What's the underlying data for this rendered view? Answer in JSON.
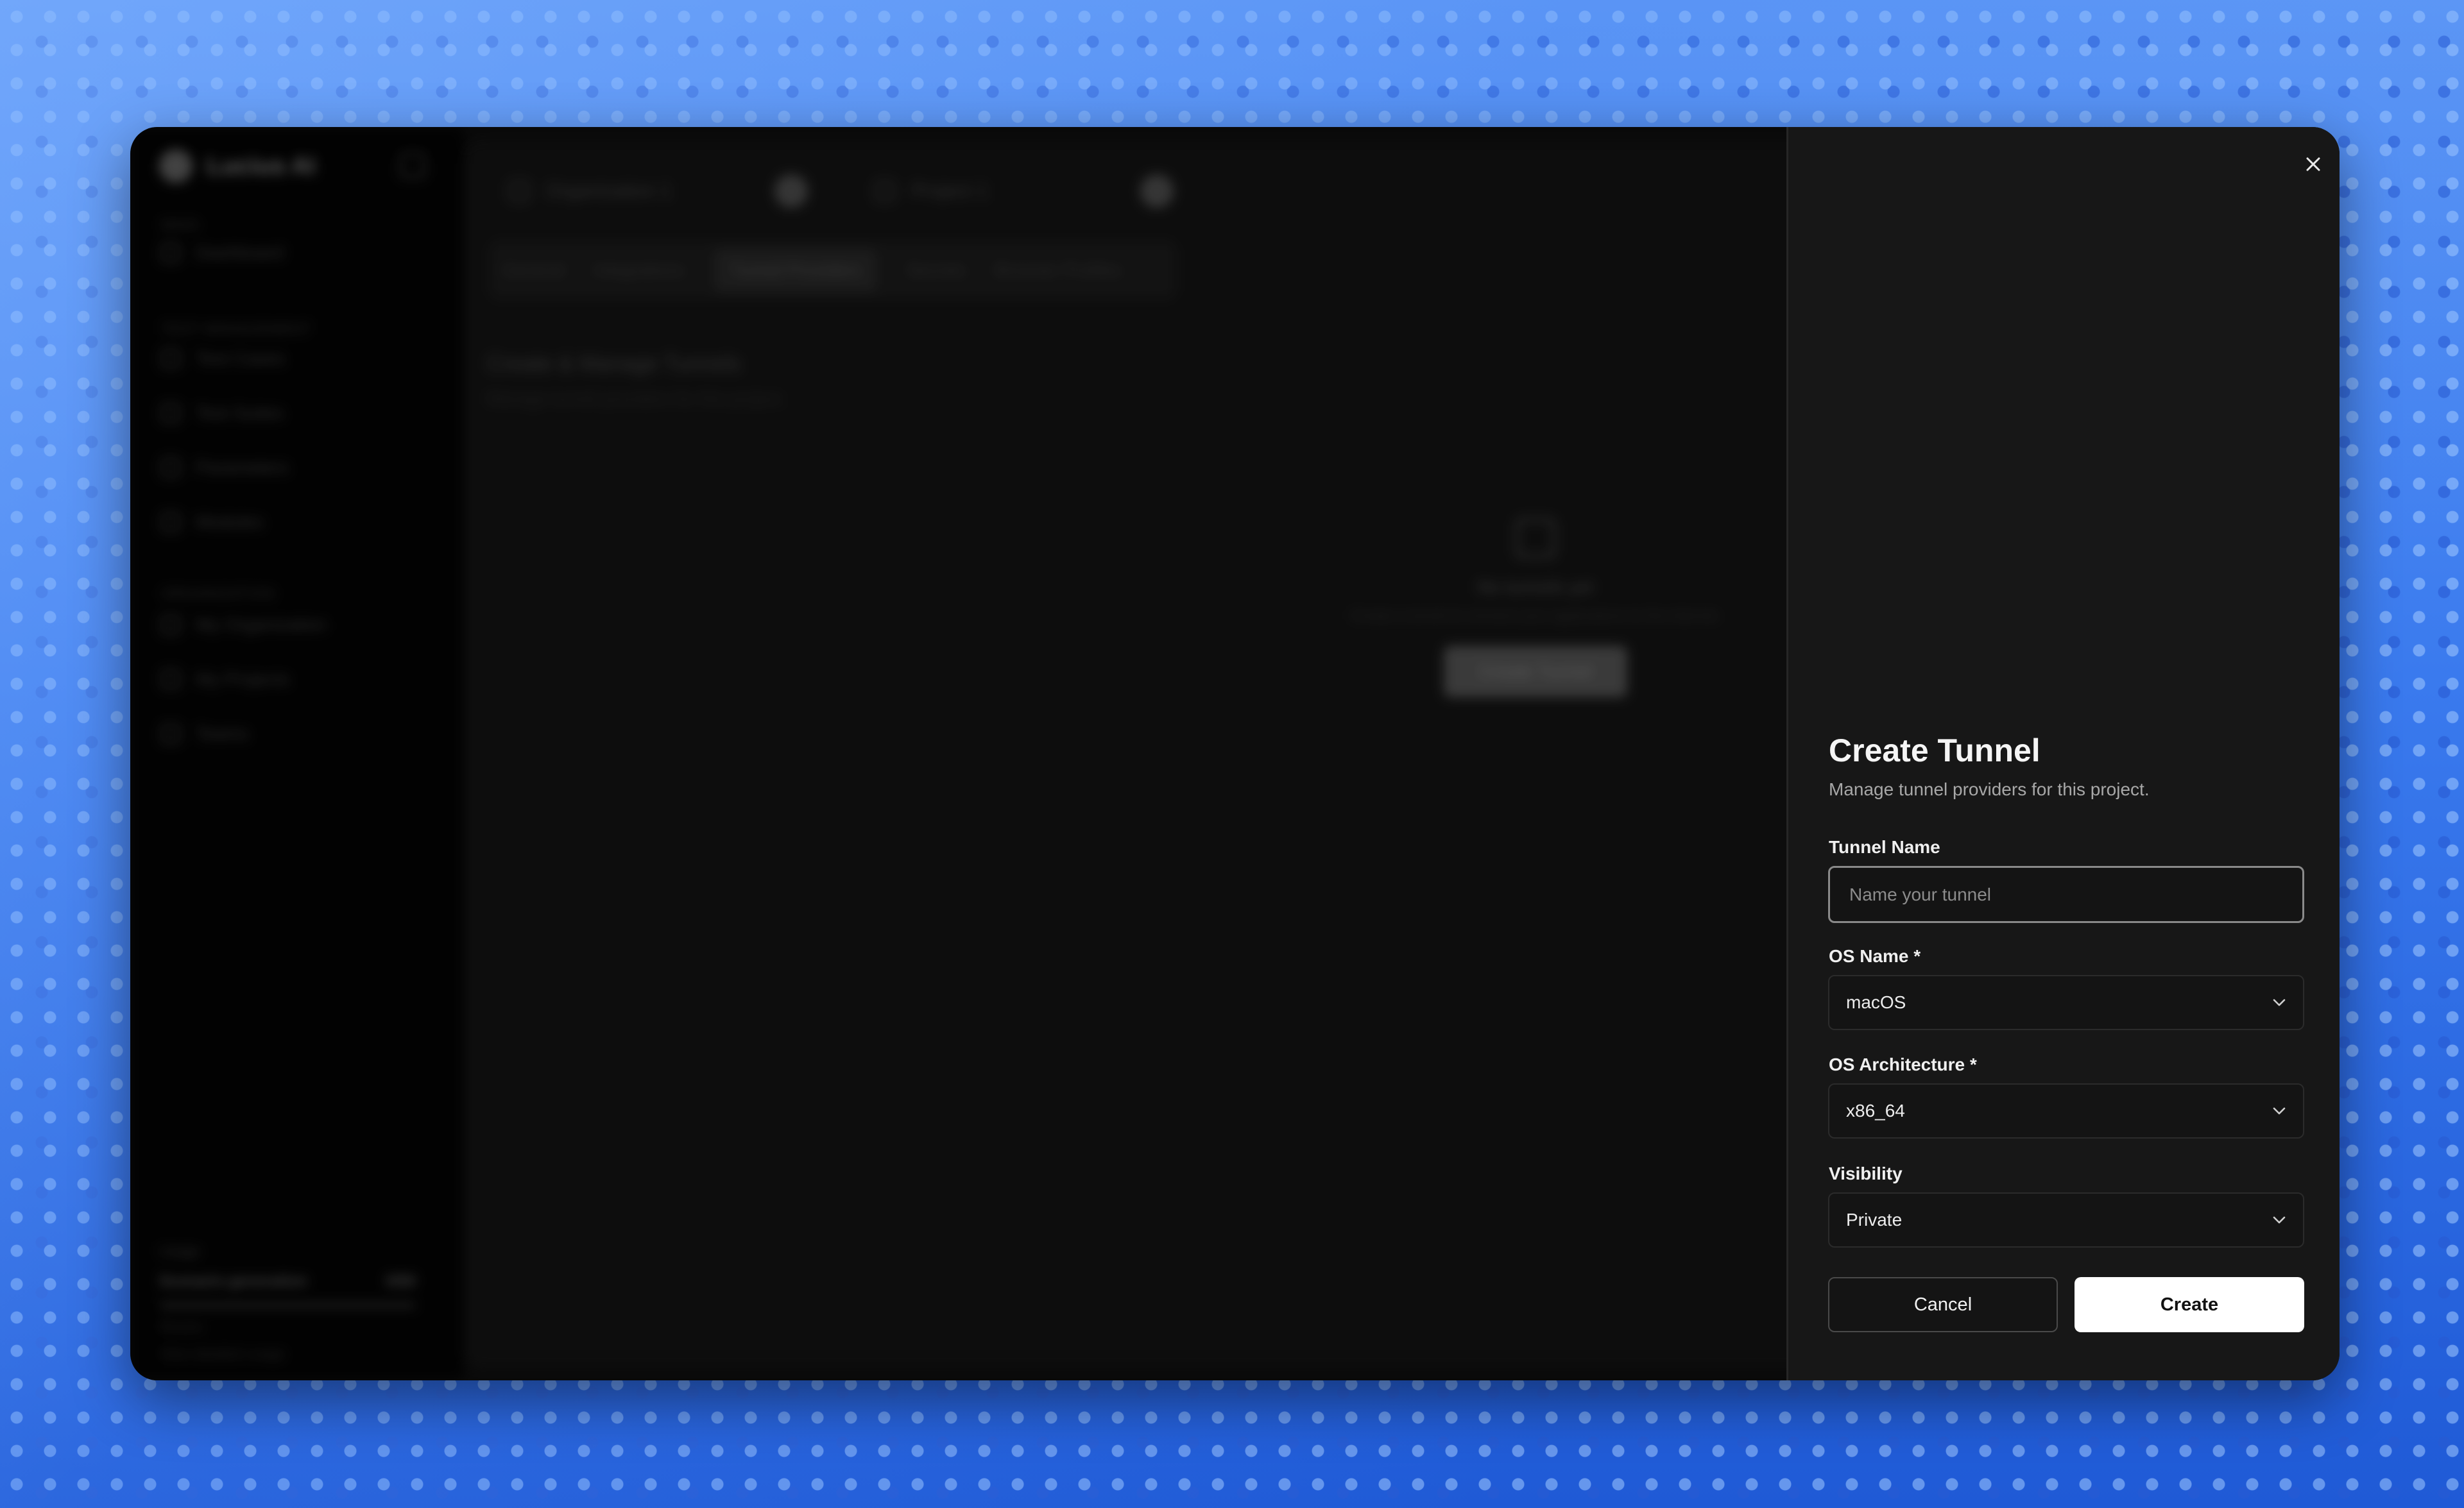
{
  "background_app": {
    "brand": "Lucius AI",
    "sidebar": {
      "sections": [
        {
          "label": "MAIN",
          "items": [
            "Dashboard"
          ]
        },
        {
          "label": "TEST MANAGEMENT",
          "items": [
            "Test Cases",
            "Test Suites",
            "Parameters",
            "Modules"
          ]
        },
        {
          "label": "ORGANIZATION",
          "items": [
            "My Organization",
            "My Projects",
            "Teams"
          ]
        }
      ],
      "usage": {
        "label": "Usage",
        "metric": "Scenario generation",
        "count": "0/50",
        "reset": "Resets",
        "note": "View detailed usage"
      }
    },
    "org_selector": "Organization 1",
    "project_selector": "Project 1",
    "tabs": [
      "General",
      "Integrations",
      "Tunnel Providers",
      "Secrets",
      "Browser Profiles"
    ],
    "active_tab": "Tunnel Providers",
    "heading": "Create & Manage Tunnels",
    "subheading": "Manage tunnel providers for this project.",
    "empty_state": {
      "title": "No tunnels yet",
      "description": "Create a tunnel to connect your applications to the internet.",
      "button": "Create Tunnel"
    }
  },
  "drawer": {
    "title": "Create Tunnel",
    "description": "Manage tunnel providers for this project.",
    "tunnel_name": {
      "label": "Tunnel Name",
      "placeholder": "Name your tunnel",
      "value": ""
    },
    "os_name": {
      "label": "OS Name *",
      "value": "macOS"
    },
    "os_architecture": {
      "label": "OS Architecture *",
      "value": "x86_64"
    },
    "visibility": {
      "label": "Visibility",
      "value": "Private"
    },
    "cancel_label": "Cancel",
    "create_label": "Create",
    "close_icon": "close-icon"
  },
  "colors": {
    "drawer_bg": "#171717",
    "primary_button": "#ffffff",
    "page_bg": "#2f6ce0"
  }
}
